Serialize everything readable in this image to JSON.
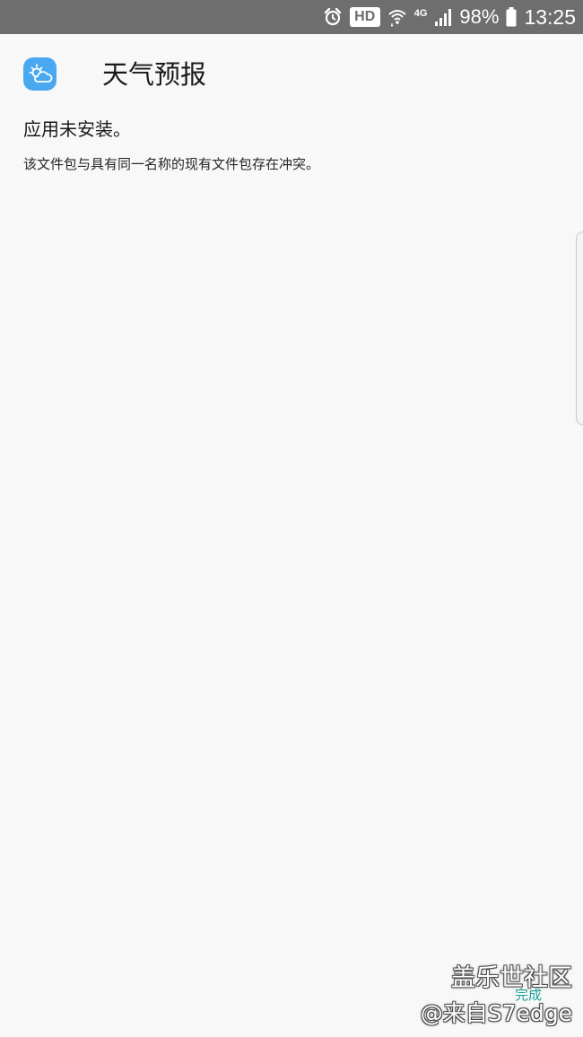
{
  "status_bar": {
    "hd_label": "HD",
    "network_label": "4G",
    "battery_percent": "98%",
    "time": "13:25",
    "icons": [
      "alarm-icon",
      "wifi-icon",
      "signal-icon",
      "battery-icon"
    ],
    "background_color": "#6e6e6e"
  },
  "app": {
    "name": "天气预报",
    "icon": "weather-cloud-sun-icon",
    "icon_color": "#4aa8f0"
  },
  "install_result": {
    "title": "应用未安装。",
    "detail": "该文件包与具有同一名称的现有文件包存在冲突。"
  },
  "footer": {
    "done_label": "完成",
    "accent_color": "#1a9e96"
  },
  "watermark": {
    "line1": "盖乐世社区",
    "line2": "@来自S7edge"
  }
}
